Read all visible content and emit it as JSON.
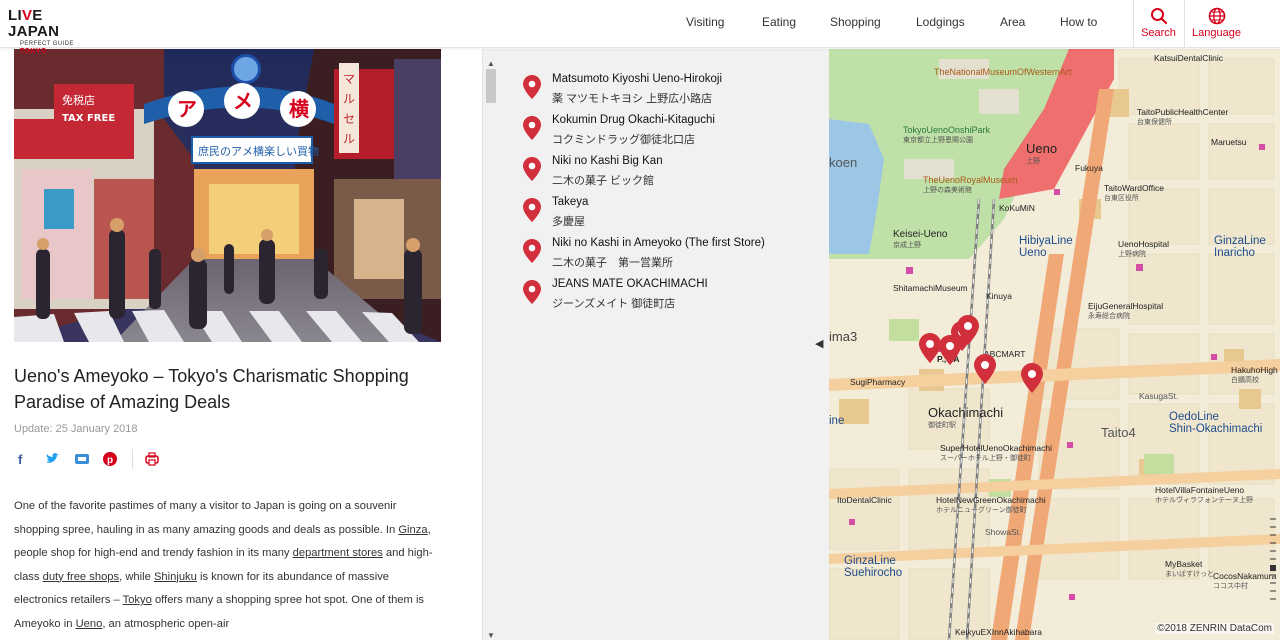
{
  "header": {
    "logo_main_prefix": "LI",
    "logo_main_accent": "V",
    "logo_main_suffix": "E JAPAN",
    "logo_sub": "PERFECT GUIDE",
    "logo_sub_city": "TOKYO",
    "nav": [
      "Visiting",
      "Eating",
      "Shopping",
      "Lodgings",
      "Area",
      "How to"
    ],
    "search_label": "Search",
    "language_label": "Language"
  },
  "article": {
    "title": "Ueno's Ameyoko – Tokyo's Charismatic Shopping Paradise of Amazing Deals",
    "update": "Update: 25 January 2018",
    "body": {
      "p1": "One of the favorite pastimes of many a visitor to Japan is going on a souvenir shopping spree, hauling in as many amazing goods and deals as possible. In ",
      "link_ginza": "Ginza",
      "p2": ", people shop for high-end and trendy fashion in its many ",
      "link_dept": "department stores",
      "p3": " and high-class ",
      "link_dutyfree": "duty free shops",
      "p4": ", while ",
      "link_shinjuku": "Shinjuku",
      "p5": " is known for its abundance of massive electronics retailers – ",
      "link_tokyo": "Tokyo",
      "p6": " offers many a shopping spree hot spot. One of them is Ameyoko in ",
      "link_ueno": "Ueno",
      "p7": ", an atmospheric open-air"
    },
    "hero": {
      "sign_ame": "アメ横",
      "sign_sub": "庶民のアメ横楽しい買物",
      "sign_taxfree_jp": "免税店",
      "sign_taxfree": "TAX FREE",
      "sign_marusel": "マルセル"
    }
  },
  "stores": [
    {
      "name": "Matsumoto Kiyoshi Ueno-Hirokoji",
      "jname": "薬 マツモトキヨシ 上野広小路店"
    },
    {
      "name": "Kokumin Drug Okachi-Kitaguchi",
      "jname": "コクミンドラッグ御徒北口店"
    },
    {
      "name": "Niki no Kashi Big Kan",
      "jname": "二木の菓子 ビック館"
    },
    {
      "name": "Takeya",
      "jname": "多慶屋"
    },
    {
      "name": "Niki no Kashi in Ameyoko (The first Store)",
      "jname": "二木の菓子　第一営業所"
    },
    {
      "name": "JEANS MATE OKACHIMACHI",
      "jname": "ジーンズメイト 御徒町店"
    }
  ],
  "map": {
    "labels": {
      "museum": "TheNationalMuseumOfWesternArt",
      "onshi_park": "TokyoUenoOnshiPark",
      "onshi_park_jp": "東京都立上野恩賜公園",
      "royal_museum": "TheUenoRoyalMuseum",
      "royal_museum_jp": "上野の森美術館",
      "ueno": "Ueno",
      "ueno_jp": "上野",
      "katsui": "KatsuiDentalClinic",
      "taito_health": "TaitoPublicHealthCenter",
      "taito_health_jp": "台東保健所",
      "maruetsu": "Maruetsu",
      "fukuya": "Fukuya",
      "taito_ward": "TaitoWardOffice",
      "taito_ward_jp": "台東区役所",
      "kokumin": "KoKuMiN",
      "koen": "koen",
      "keisei_ueno": "Keisei-Ueno",
      "keisei_ueno_jp": "京成上野",
      "hibiya_ueno": "HibiyaLine\nUeno",
      "ueno_hospital": "UenoHospital",
      "ueno_hospital_jp": "上野病院",
      "ginza_inaricho": "GinzaLine\nInaricho",
      "shitamachi": "ShitamachiMuseum",
      "kinuya": "Kinuya",
      "eiju": "EijuGeneralHospital",
      "eiju_jp": "永寿総合病院",
      "ima3": "ima3",
      "parco": "P.,  FA",
      "abc": "ABCMART",
      "sugi": "SugiPharmacy",
      "hakuho": "HakuhoHigh",
      "hakuho_jp": "白鵬高校",
      "kasuga": "KasugaSt.",
      "okachimachi": "Okachimachi",
      "okachimachi_jp": "御徒町駅",
      "oedo": "OedoLine\nShin-Okachimachi",
      "taito4": "Taito4",
      "ine": "ine",
      "super_hotel": "SuperHotelUenoOkachimachi",
      "super_hotel_jp": "スーパーホテル上野・御徒町",
      "itodental": "ItoDentalClinic",
      "hotel_green": "HotelNewGreenOkachimachi",
      "hotel_green_jp": "ホテルニューグリーン御徒町",
      "showa": "ShowaSt.",
      "hotel_villa": "HotelVillaFontaineUeno",
      "hotel_villa_jp": "ホテルヴィラフォンテーヌ上野",
      "ginza_suehirocho": "GinzaLine\nSuehirocho",
      "mybasket": "MyBasket",
      "mybasket_jp": "まいばすけっと",
      "cocos": "CocosNakamura",
      "cocos_jp": "ココス中村",
      "keikyu": "KeikyuEXInnAkihabara"
    },
    "attribution": "©2018 ZENRIN DataCom"
  },
  "colors": {
    "accent": "#d6001c",
    "pin": "#d22f3c",
    "map_bg": "#f2ecd9",
    "park": "#bfe0a6",
    "water": "#9cc6e6",
    "rail_red": "#ef6e6e",
    "road_orange": "#f0a877"
  }
}
